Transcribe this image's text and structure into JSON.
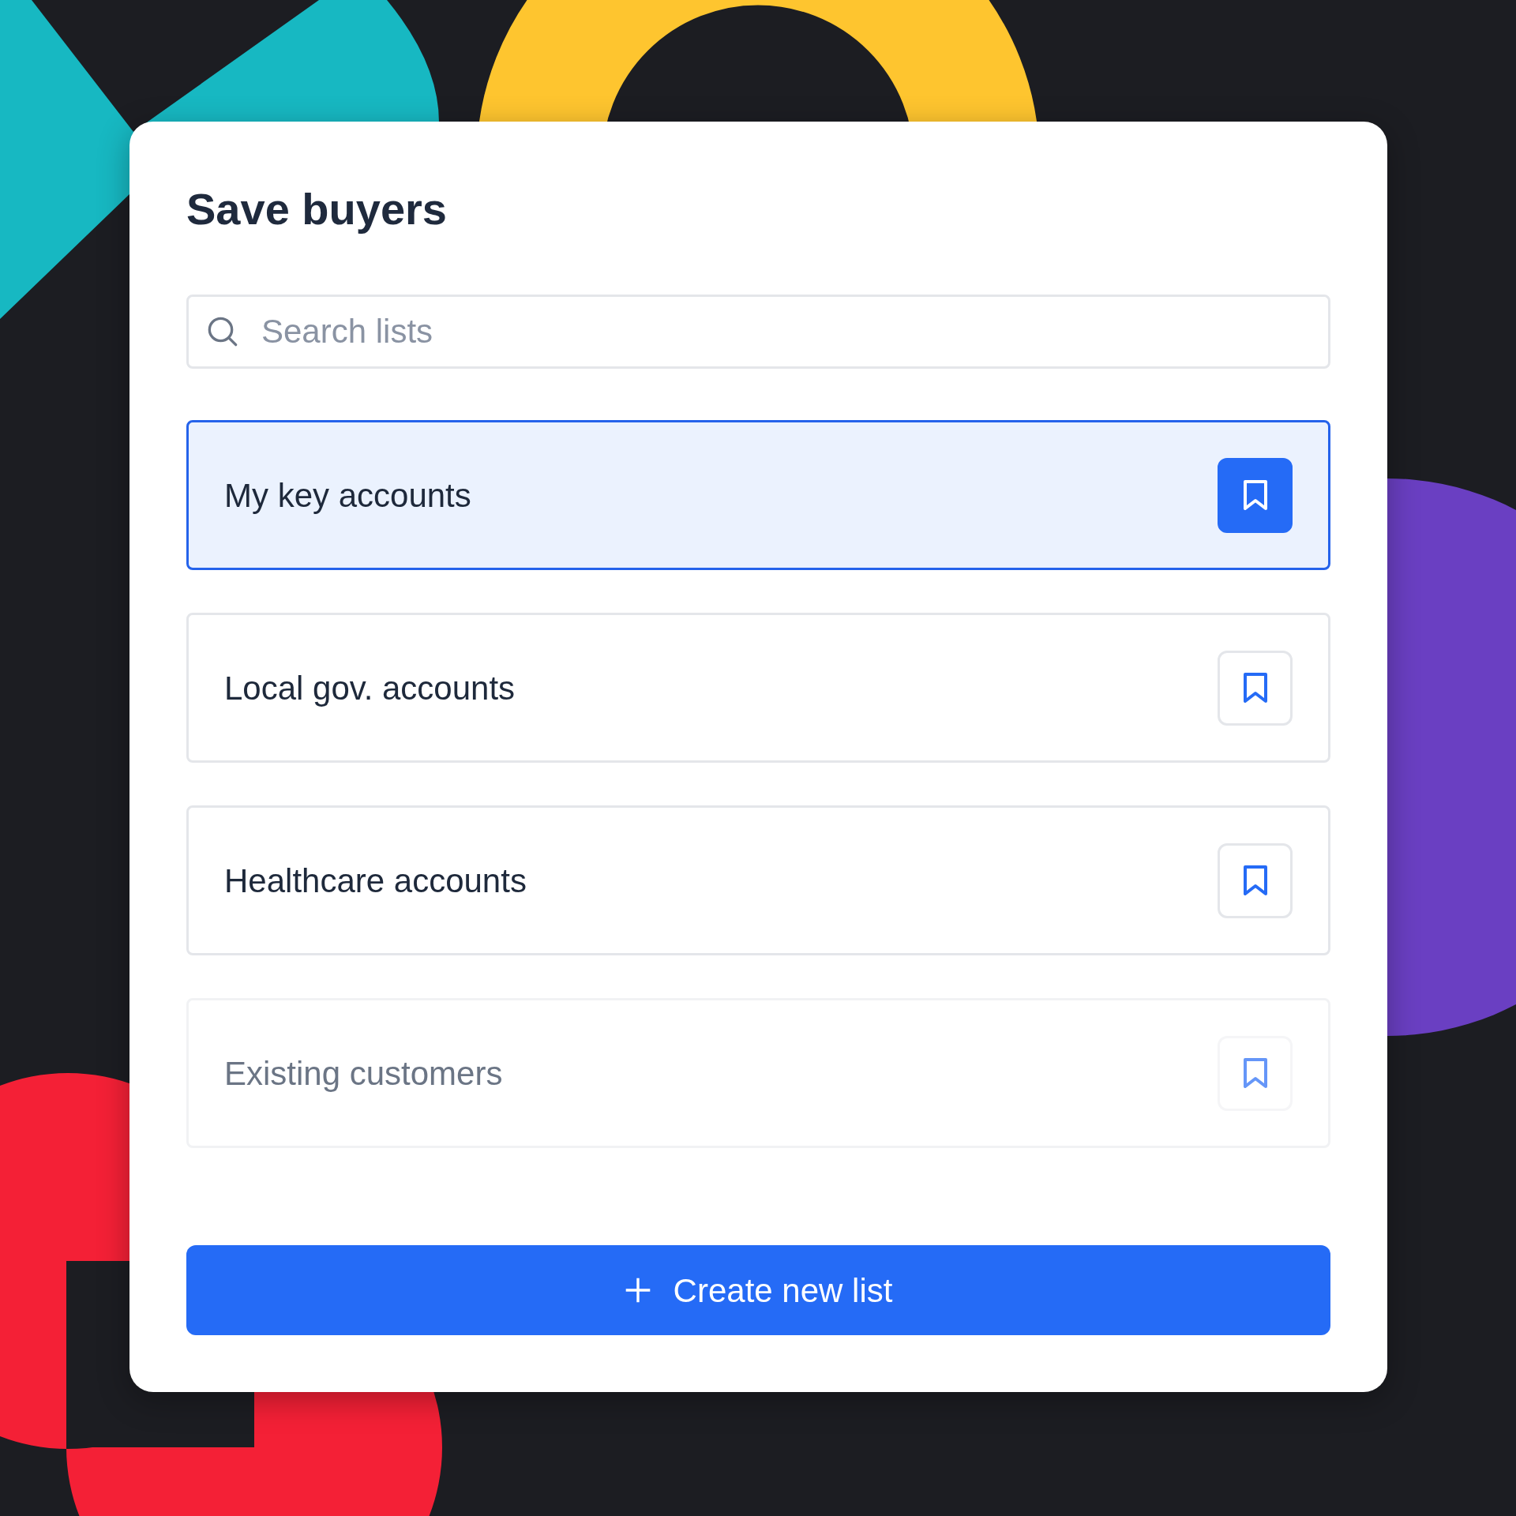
{
  "dialog": {
    "title": "Save buyers"
  },
  "search": {
    "placeholder": "Search lists"
  },
  "lists": [
    {
      "name": "My key accounts",
      "selected": true,
      "disabled": false
    },
    {
      "name": "Local gov. accounts",
      "selected": false,
      "disabled": false
    },
    {
      "name": "Healthcare accounts",
      "selected": false,
      "disabled": false
    },
    {
      "name": "Existing customers",
      "selected": false,
      "disabled": true
    }
  ],
  "create_button": {
    "label": "Create new list"
  }
}
